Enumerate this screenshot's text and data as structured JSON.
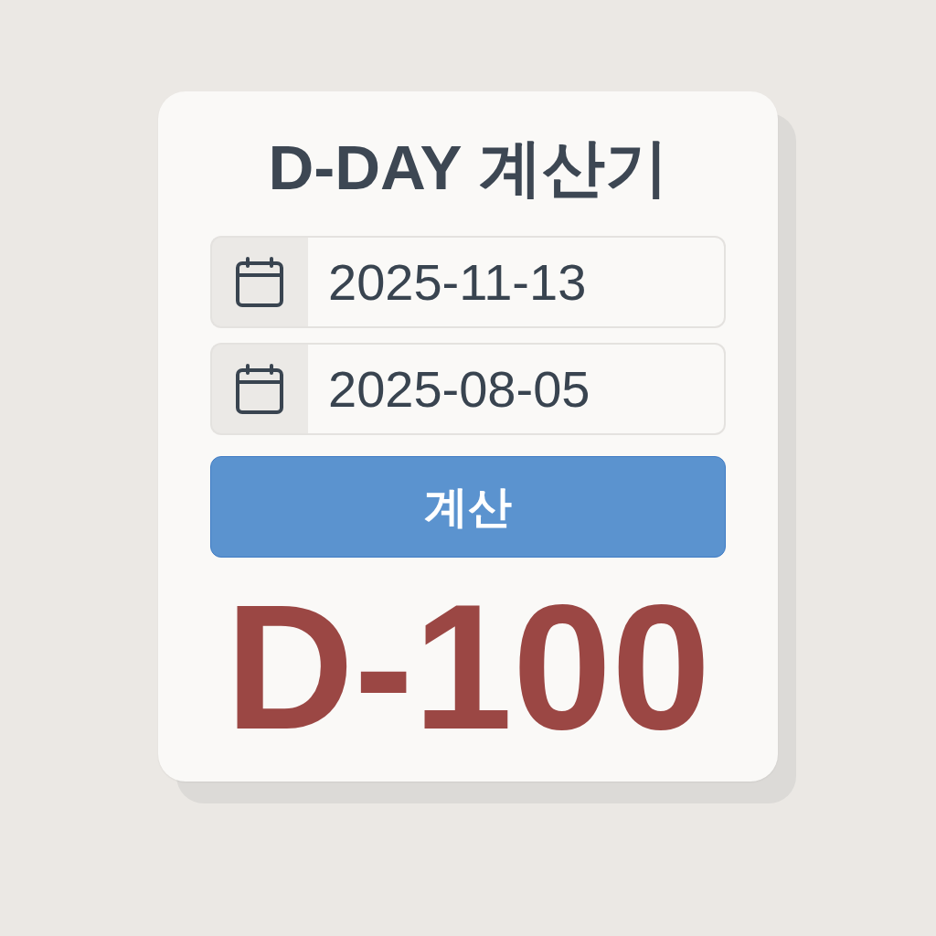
{
  "title": "D-DAY 계산기",
  "date_fields": [
    {
      "value": "2025-11-13"
    },
    {
      "value": "2025-08-05"
    }
  ],
  "calculate_button": {
    "label": "계산"
  },
  "result": "D-100"
}
